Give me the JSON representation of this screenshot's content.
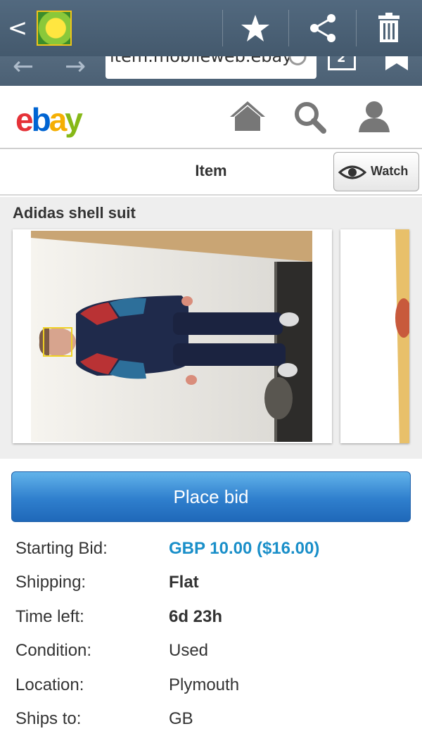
{
  "gallery_bar": {
    "back_glyph": "<",
    "actions": [
      "star-icon",
      "share-icon",
      "trash-icon"
    ]
  },
  "browser": {
    "url": "item.mobileweb.ebay",
    "tab_count": "2"
  },
  "ebay_header": {
    "logo": {
      "e": "e",
      "b": "b",
      "a": "a",
      "y": "y"
    },
    "colors": {
      "e": "#e53238",
      "b": "#0064d2",
      "a": "#f5af02",
      "y": "#86b817"
    },
    "nav_icons": [
      "home-icon",
      "search-icon",
      "account-icon"
    ]
  },
  "item_bar": {
    "title": "Item",
    "watch_label": "Watch"
  },
  "item": {
    "name": "Adidas shell suit"
  },
  "bid_button": {
    "label": "Place bid",
    "color": "#2f7fcd"
  },
  "details": [
    {
      "label": "Starting Bid:",
      "value": "GBP 10.00 ($16.00)",
      "style": "price"
    },
    {
      "label": "Shipping:",
      "value": "Flat",
      "style": "bold"
    },
    {
      "label": "Time left:",
      "value": "6d 23h",
      "style": "bold"
    },
    {
      "label": "Condition:",
      "value": "Used",
      "style": "plain"
    },
    {
      "label": "Location:",
      "value": "Plymouth",
      "style": "plain"
    },
    {
      "label": "Ships to:",
      "value": "GB",
      "style": "plain"
    }
  ]
}
